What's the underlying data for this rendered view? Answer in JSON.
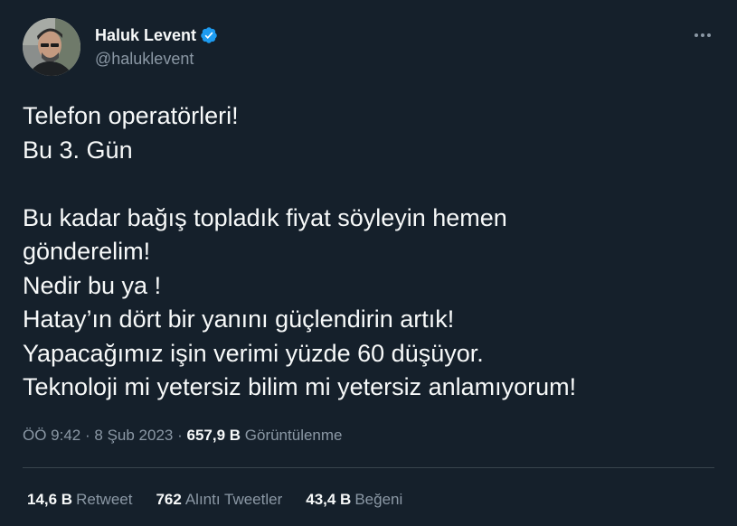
{
  "author": {
    "display_name": "Haluk Levent",
    "handle": "@haluklevent",
    "verified_badge_icon": "verified-badge-icon",
    "badge_color": "#1d9bf0"
  },
  "tweet": {
    "lines": [
      "Telefon operatörleri!",
      "Bu 3. Gün",
      "",
      "Bu kadar bağış topladık fiyat söyleyin hemen",
      "gönderelim!",
      "Nedir bu ya !",
      "Hatay’ın dört bir yanını güçlendirin artık!",
      "Yapacağımız işin verimi yüzde 60 düşüyor.",
      "Teknoloji mi yetersiz bilim mi yetersiz anlamıyorum!"
    ]
  },
  "meta": {
    "time": "ÖÖ 9:42",
    "separator": "·",
    "date": "8 Şub 2023",
    "views_count": "657,9 B",
    "views_label": "Görüntülenme"
  },
  "stats": {
    "retweets_count": "14,6 B",
    "retweets_label": "Retweet",
    "quotes_count": "762",
    "quotes_label": "Alıntı Tweetler",
    "likes_count": "43,4 B",
    "likes_label": "Beğeni"
  },
  "theme": {
    "background": "#15202b",
    "text_primary": "#f7f9f9",
    "text_secondary": "#8b98a5",
    "divider": "#38444d"
  }
}
